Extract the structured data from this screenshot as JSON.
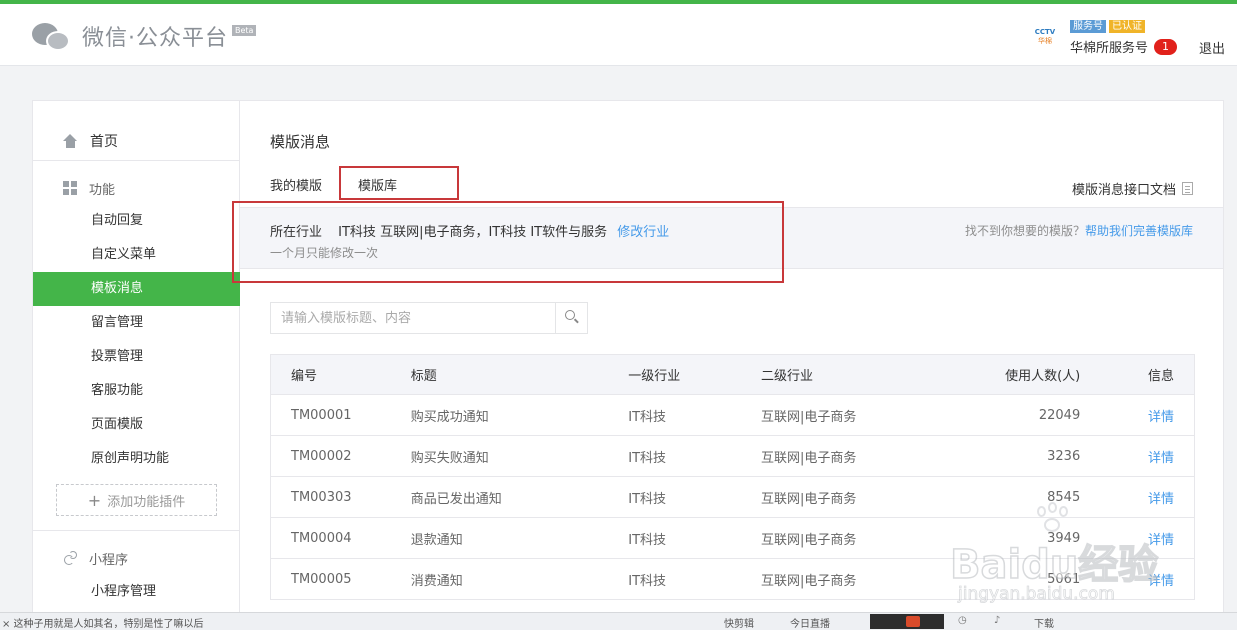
{
  "header": {
    "brand": "微信·公众平台",
    "beta": "Beta",
    "account_logo": "CCTV",
    "account_logo_sub": "华棉",
    "account_type": "服务号",
    "verified": "已认证",
    "account_name": "华棉所服务号",
    "notification_count": "1",
    "logout": "退出"
  },
  "sidebar": {
    "home": "首页",
    "function_section": "功能",
    "items": [
      "自动回复",
      "自定义菜单",
      "模板消息",
      "留言管理",
      "投票管理",
      "客服功能",
      "页面模版",
      "原创声明功能"
    ],
    "active_index": 2,
    "add_plugin": "添加功能插件",
    "miniprogram_section": "小程序",
    "miniprogram_items": [
      "小程序管理"
    ]
  },
  "content": {
    "title": "模版消息",
    "tabs": [
      "我的模版",
      "模版库"
    ],
    "active_tab": 1,
    "doc_link": "模版消息接口文档",
    "industry": {
      "label": "所在行业",
      "values": "IT科技 互联网|电子商务，IT科技 IT软件与服务",
      "edit_link": "修改行业",
      "note": "一个月只能修改一次",
      "help_text": "找不到你想要的模版？",
      "help_link": "帮助我们完善模版库"
    },
    "search": {
      "placeholder": "请输入模版标题、内容",
      "value": ""
    },
    "table": {
      "headers": [
        "编号",
        "标题",
        "一级行业",
        "二级行业",
        "使用人数(人)",
        "信息"
      ],
      "rows": [
        {
          "id": "TM00001",
          "title": "购买成功通知",
          "industry1": "IT科技",
          "industry2": "互联网|电子商务",
          "users": "22049",
          "info": "详情"
        },
        {
          "id": "TM00002",
          "title": "购买失败通知",
          "industry1": "IT科技",
          "industry2": "互联网|电子商务",
          "users": "3236",
          "info": "详情"
        },
        {
          "id": "TM00303",
          "title": "商品已发出通知",
          "industry1": "IT科技",
          "industry2": "互联网|电子商务",
          "users": "8545",
          "info": "详情"
        },
        {
          "id": "TM00004",
          "title": "退款通知",
          "industry1": "IT科技",
          "industry2": "互联网|电子商务",
          "users": "3949",
          "info": "详情"
        },
        {
          "id": "TM00005",
          "title": "消费通知",
          "industry1": "IT科技",
          "industry2": "互联网|电子商务",
          "users": "5061",
          "info": "详情"
        }
      ]
    }
  },
  "watermark": {
    "brand": "Baidu经验",
    "url": "jingyan.baidu.com"
  },
  "taskbar": {
    "left_text": "×  这种子用就是人如其名，特别是性了嘛以后",
    "clip": "快剪辑",
    "live": "今日直播",
    "download": "下载"
  },
  "colors": {
    "accent_green": "#44b549",
    "link_blue": "#459ae9",
    "highlight_red": "#c8383a",
    "badge_red": "#e1211b"
  }
}
